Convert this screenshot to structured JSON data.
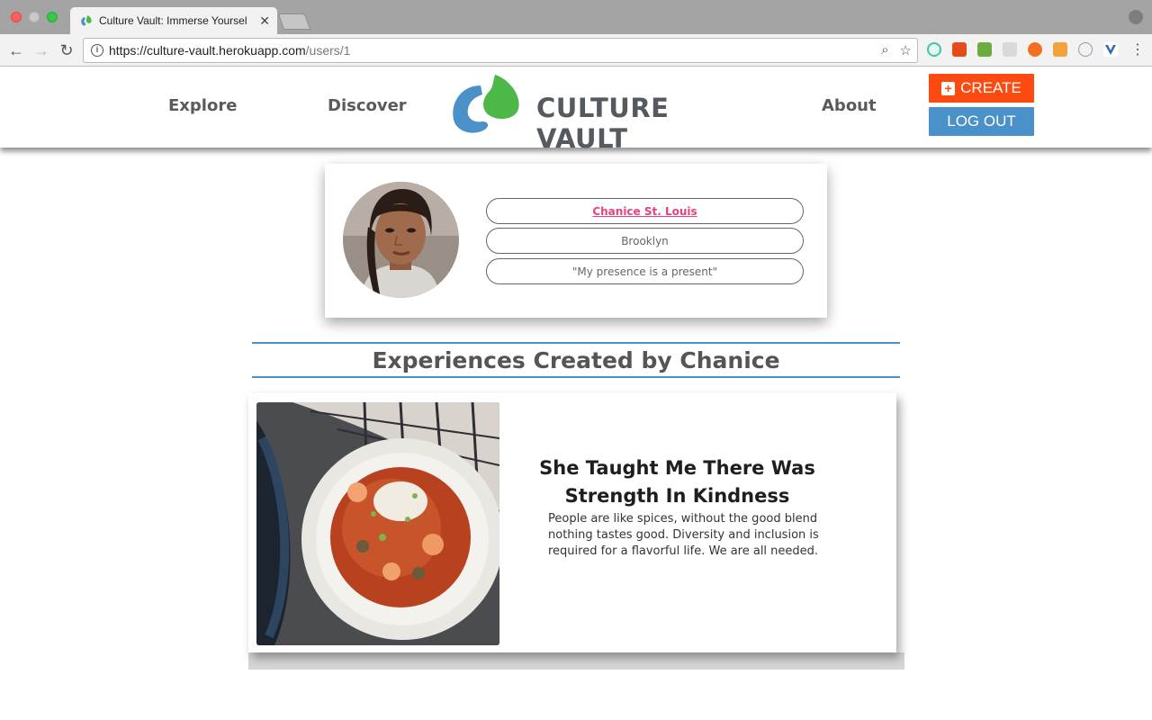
{
  "browser": {
    "tab_title": "Culture Vault: Immerse Yoursel",
    "tab_close": "✕",
    "url_host": "https://culture-vault.herokuapp.com",
    "url_path": "/users/1",
    "back_glyph": "←",
    "forward_glyph": "→",
    "reload_glyph": "↻",
    "zoom_glyph": "⌕",
    "star_glyph": "☆",
    "menu_glyph": "⋮"
  },
  "header": {
    "nav": [
      "Explore",
      "Discover",
      "About"
    ],
    "logo_text": "CULTURE VAULT",
    "create_label": "CREATE",
    "create_plus": "+",
    "logout_label": "LOG OUT",
    "colors": {
      "create": "#fc4a10",
      "logout": "#4a90c9",
      "logo_blue": "#4a90c9",
      "logo_green": "#4cb848"
    }
  },
  "profile": {
    "name": "Chanice St. Louis",
    "location": "Brooklyn",
    "quote": "\"My presence is a present\""
  },
  "section": {
    "heading": "Experiences Created by Chanice"
  },
  "experiences": [
    {
      "title": "She Taught Me There Was Strength In Kindness",
      "description": "People are like spices, without the good blend nothing tastes good. Diversity and inclusion is required for a flavorful life. We are all needed."
    }
  ]
}
